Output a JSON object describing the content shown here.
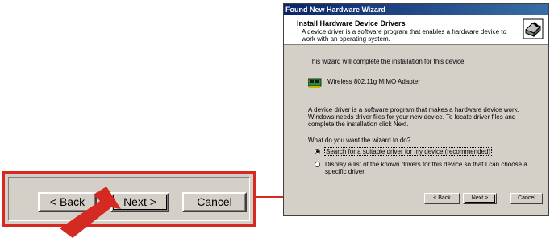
{
  "wizard": {
    "title": "Found New Hardware Wizard",
    "header_title": "Install Hardware Device Drivers",
    "header_subtitle": "A device driver is a software program that enables a hardware device to work with an operating system.",
    "intro": "This wizard will complete the installation for this device:",
    "device_name": "Wireless 802.11g MIMO Adapter",
    "description": "A device driver is a software program that makes a hardware device work. Windows needs driver files for your new device. To locate driver files and complete the installation click Next.",
    "question": "What do you want the wizard to do?",
    "options": [
      {
        "label": "Search for a suitable driver for my device (recommended)",
        "selected": true
      },
      {
        "label": "Display a list of the known drivers for this device so that I can choose a specific driver",
        "selected": false
      }
    ],
    "buttons": {
      "back": "< Back",
      "next": "Next >",
      "cancel": "Cancel"
    }
  },
  "zoom": {
    "buttons": {
      "back": "< Back",
      "next": "Next >",
      "cancel": "Cancel"
    },
    "highlight_color": "#d42a22"
  }
}
